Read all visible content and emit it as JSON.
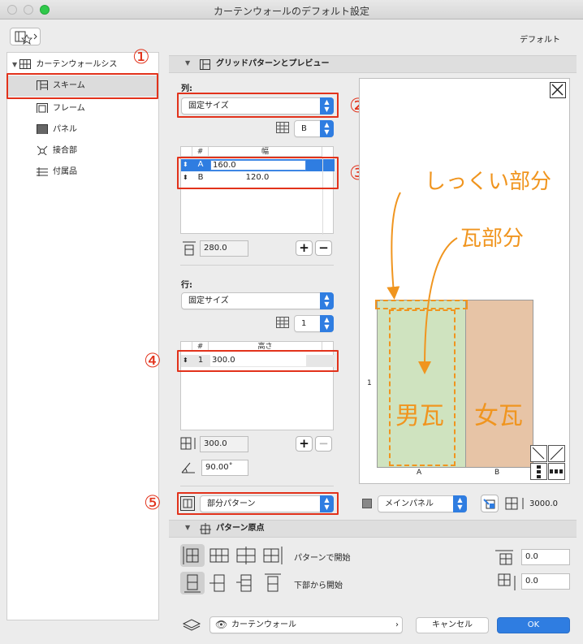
{
  "window": {
    "title": "カーテンウォールのデフォルト設定"
  },
  "header": {
    "default_label": "デフォルト"
  },
  "sidebar": {
    "root": "カーテンウォールシス",
    "items": [
      "スキーム",
      "フレーム",
      "パネル",
      "接合部",
      "付属品"
    ]
  },
  "markers": [
    "①",
    "②",
    "③",
    "④",
    "⑤"
  ],
  "grid_section": {
    "title": "グリッドパターンとプレビュー",
    "column_label": "列:",
    "column_mode": "固定サイズ",
    "column_select": "B",
    "col_table": {
      "headers": [
        "#",
        "幅"
      ],
      "rows": [
        {
          "id": "A",
          "value": "160.0"
        },
        {
          "id": "B",
          "value": "120.0"
        }
      ]
    },
    "total_width": "280.0",
    "row_label": "行:",
    "row_mode": "固定サイズ",
    "row_select": "1",
    "row_table": {
      "headers": [
        "#",
        "高さ"
      ],
      "rows": [
        {
          "id": "1",
          "value": "300.0"
        }
      ]
    },
    "total_height": "300.0",
    "angle": "90.00˚",
    "pattern_select": "部分パターン",
    "panel_select": "メインパネル",
    "height_value": "3000.0"
  },
  "preview": {
    "row_label": "1",
    "col_labels": [
      "A",
      "B"
    ],
    "annotations": {
      "sill": "しっくい部分",
      "tile": "瓦部分",
      "male_tile": "男瓦",
      "female_tile": "女瓦"
    },
    "colors": {
      "panel_a": "#cfe3bf",
      "panel_b": "#e7c4a6",
      "annotation": "#f0951f"
    }
  },
  "origin_section": {
    "title": "パターン原点",
    "start_pattern_label": "パターンで開始",
    "start_bottom_label": "下部から開始",
    "offset_x": "0.0",
    "offset_y": "0.0"
  },
  "footer": {
    "layer": "カーテンウォール",
    "cancel": "キャンセル",
    "ok": "OK"
  }
}
